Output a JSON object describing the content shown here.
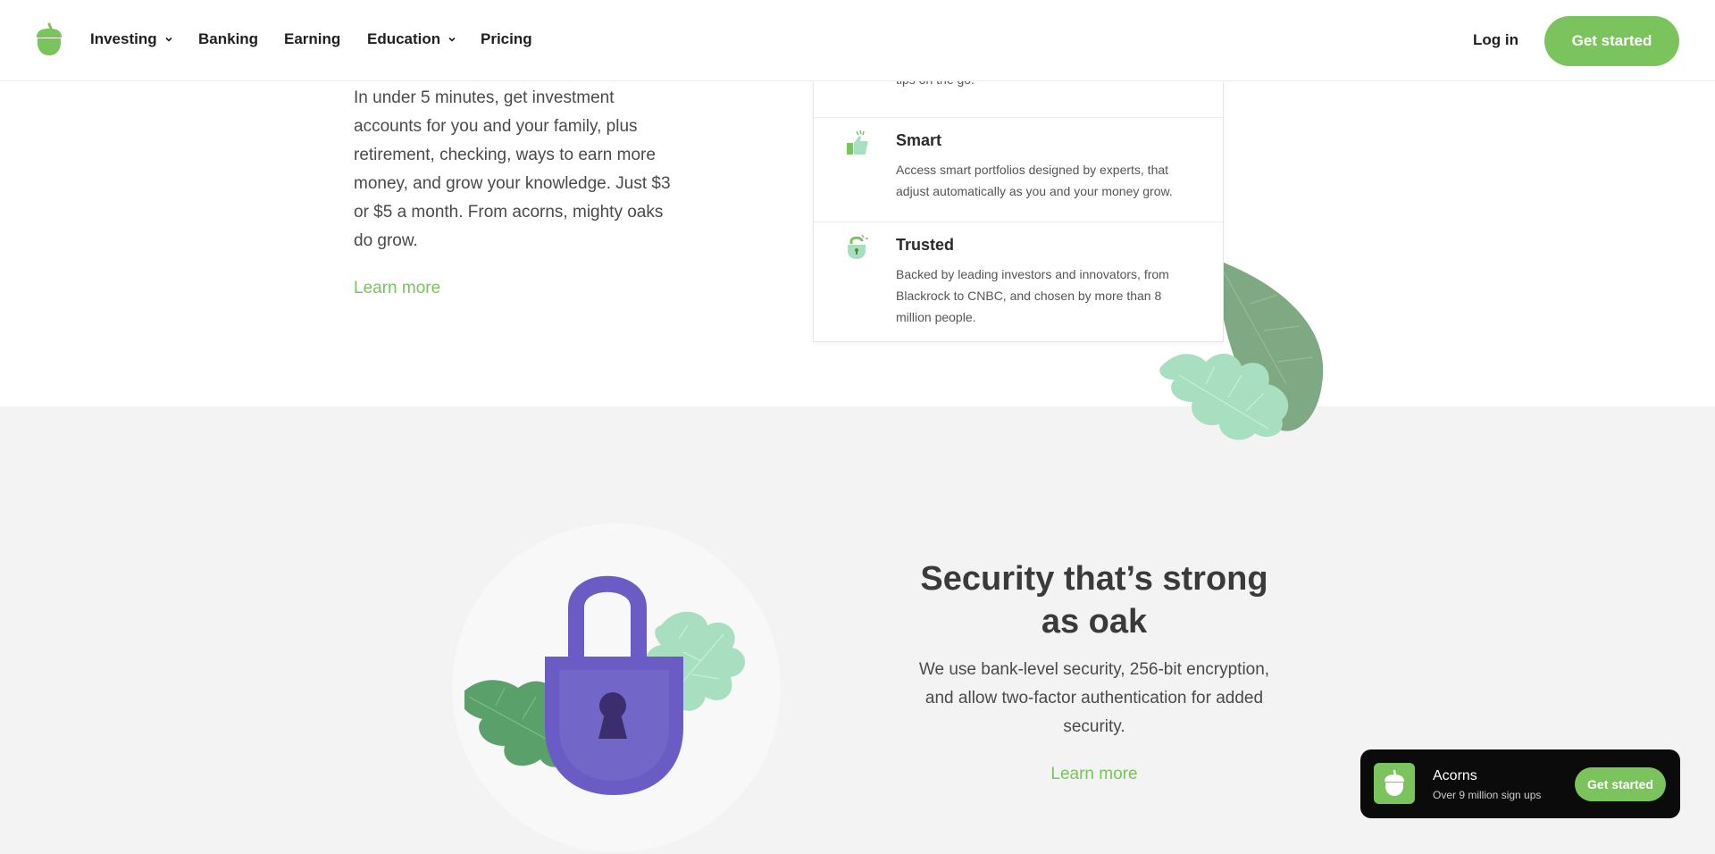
{
  "nav": {
    "items": [
      {
        "label": "Investing",
        "has_dropdown": true
      },
      {
        "label": "Banking",
        "has_dropdown": false
      },
      {
        "label": "Earning",
        "has_dropdown": false
      },
      {
        "label": "Education",
        "has_dropdown": true
      },
      {
        "label": "Pricing",
        "has_dropdown": false
      }
    ],
    "login": "Log in",
    "cta": "Get started"
  },
  "intro": {
    "text": "In under 5 minutes, get investment accounts for you and your family, plus retirement, checking, ways to earn more money, and grow your knowledge. Just $3 or $5 a month. From acorns, mighty oaks do grow.",
    "learn_more": "Learn more"
  },
  "features": {
    "top_fragment": "tips on the go.",
    "items": [
      {
        "title": "Smart",
        "desc": "Access smart portfolios designed by experts, that adjust automatically as you and your money grow.",
        "icon": "thumbs-up-icon"
      },
      {
        "title": "Trusted",
        "desc": "Backed by leading investors and innovators, from Blackrock to CNBC, and chosen by more than 8 million people.",
        "icon": "shield-lock-icon"
      }
    ]
  },
  "security": {
    "title": "Security that’s strong as oak",
    "text": "We use bank-level security, 256-bit encryption, and allow two-factor authentication for added security.",
    "learn_more": "Learn more"
  },
  "banner": {
    "title": "Acorns",
    "subtitle": "Over 9 million sign ups",
    "cta": "Get started"
  },
  "colors": {
    "accent": "#7ac35d",
    "lock": "#6a5cc4",
    "gray_bg": "#f3f3f3"
  }
}
